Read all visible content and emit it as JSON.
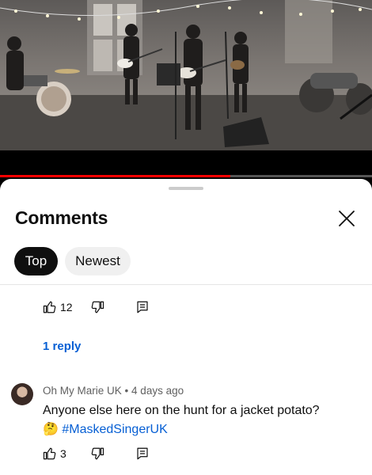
{
  "video": {
    "progress_fraction": 0.62
  },
  "comments_panel": {
    "title": "Comments",
    "close_icon": "close-icon",
    "filters": [
      {
        "label": "Top",
        "selected": true
      },
      {
        "label": "Newest",
        "selected": false
      }
    ]
  },
  "thread_1": {
    "like_count": "12",
    "reply_link": "1 reply"
  },
  "comment_2": {
    "author": "Oh My Marie UK",
    "separator": "•",
    "time": "4 days ago",
    "text": "Anyone else here on the hunt for a jacket potato?",
    "emoji": "🤔",
    "hashtag": "#MaskedSingerUK",
    "like_count": "3"
  },
  "colors": {
    "accent_red": "#ff0000",
    "link_blue": "#065fd4",
    "chip_selected": "#0f0f0f",
    "chip_unselected": "#f0f0f0"
  },
  "icons": [
    "thumbs-up-icon",
    "thumbs-down-icon",
    "reply-icon",
    "close-icon"
  ]
}
